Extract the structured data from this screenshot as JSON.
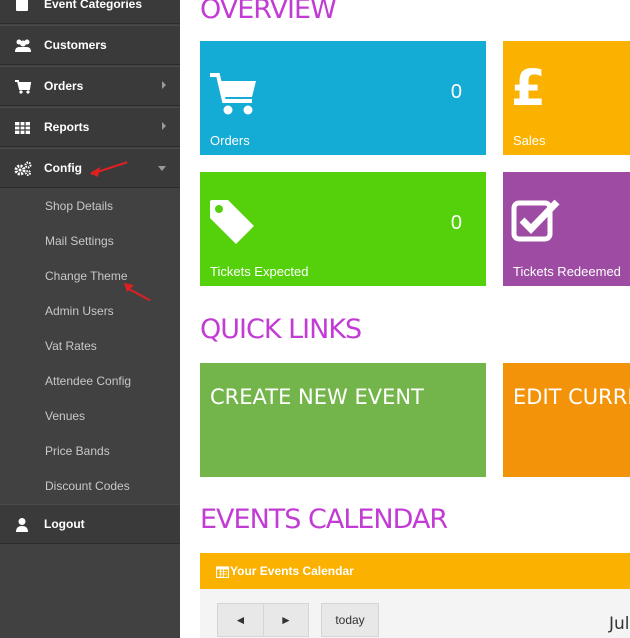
{
  "sidebar": {
    "items": [
      {
        "label": "Event Categories",
        "icon": "tag-icon"
      },
      {
        "label": "Customers",
        "icon": "users-icon"
      },
      {
        "label": "Orders",
        "icon": "cart-icon"
      },
      {
        "label": "Reports",
        "icon": "table-icon"
      },
      {
        "label": "Config",
        "icon": "gears-icon"
      },
      {
        "label": "Logout",
        "icon": "user-icon"
      }
    ],
    "config_submenu": [
      "Shop Details",
      "Mail Settings",
      "Change Theme",
      "Admin Users",
      "Vat Rates",
      "Attendee Config",
      "Venues",
      "Price Bands",
      "Discount Codes"
    ]
  },
  "overview": {
    "title": "OVERVIEW",
    "tiles": [
      {
        "label": "Orders",
        "value": "0",
        "color": "#14abd4",
        "icon": "cart-icon"
      },
      {
        "label": "Sales",
        "value": "",
        "color": "#fbb100",
        "icon": "pound-icon"
      },
      {
        "label": "Tickets Expected",
        "value": "0",
        "color": "#55d10c",
        "icon": "tag-icon"
      },
      {
        "label": "Tickets Redeemed",
        "value": "",
        "color": "#9e4ba3",
        "icon": "checkbox-icon"
      }
    ]
  },
  "quick_links": {
    "title": "QUICK LINKS",
    "items": [
      {
        "label": "CREATE NEW EVENT",
        "color": "#73b54b"
      },
      {
        "label": "EDIT CURRE",
        "color": "#f39309"
      }
    ]
  },
  "events_calendar": {
    "title": "EVENTS CALENDAR",
    "header": "Your Events Calendar",
    "prev": "◄",
    "next": "►",
    "today": "today",
    "month_partial": "Jul"
  }
}
